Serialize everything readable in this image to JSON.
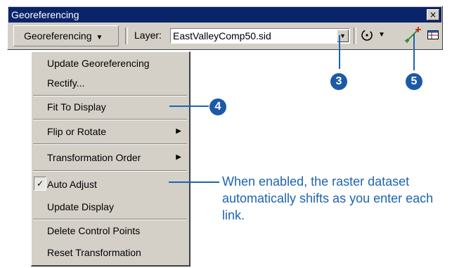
{
  "window": {
    "title": "Georeferencing",
    "close_glyph": "×"
  },
  "toolbar": {
    "menu_label": "Georeferencing",
    "menu_arrow": "▼",
    "layer_label": "Layer:",
    "layer_value": "EastValleyComp50.sid",
    "dropdown_glyph": "▼",
    "tools": [
      {
        "icon": "rotate-icon",
        "glyph": "⟳"
      },
      {
        "icon": "add-control-points-icon",
        "glyph": "+"
      },
      {
        "icon": "link-table-icon",
        "glyph": "▦"
      }
    ]
  },
  "menu": {
    "items": [
      {
        "label": "Update Georeferencing"
      },
      {
        "label": "Rectify..."
      },
      {
        "label": "Fit To Display"
      },
      {
        "label": "Flip or Rotate",
        "submenu_glyph": "▶"
      },
      {
        "label": "Transformation Order",
        "submenu_glyph": "▶"
      },
      {
        "label": "Auto Adjust",
        "checked": true,
        "check_glyph": "✓"
      },
      {
        "label": "Update Display"
      },
      {
        "label": "Delete Control Points"
      },
      {
        "label": "Reset Transformation"
      }
    ]
  },
  "callouts": {
    "badge_3": "3",
    "badge_4": "4",
    "badge_5": "5",
    "note": "When enabled, the raster dataset automatically shifts as you enter each link."
  },
  "colors": {
    "callout_blue": "#1c64b0",
    "titlebar": "#0a246a",
    "face": "#d4d0c8"
  }
}
